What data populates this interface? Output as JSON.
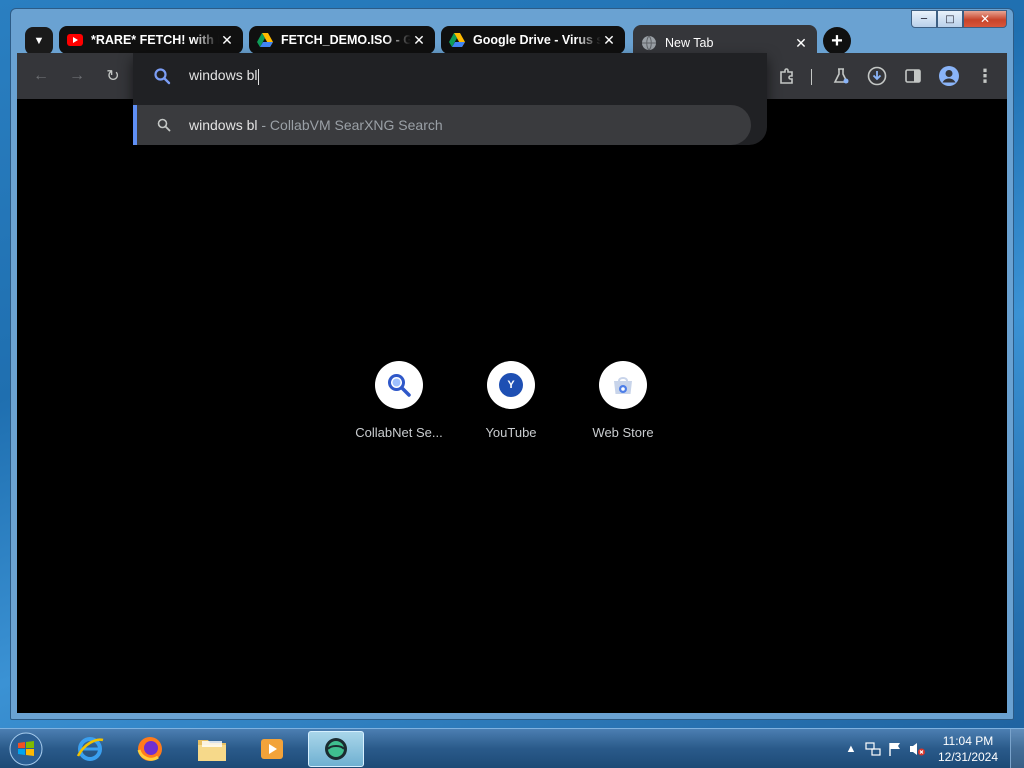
{
  "browser": {
    "tabs": [
      {
        "title": "*RARE* FETCH! with R",
        "favicon": "youtube-icon",
        "active": false
      },
      {
        "title": "FETCH_DEMO.ISO - G",
        "favicon": "google-drive-icon",
        "active": false
      },
      {
        "title": "Google Drive - Virus s",
        "favicon": "google-drive-icon",
        "active": false
      },
      {
        "title": "New Tab",
        "favicon": "globe-icon",
        "active": true
      }
    ],
    "omnibox": {
      "input_value": "windows bl",
      "suggestion_query": "windows bl",
      "suggestion_engine": " - CollabVM SearXNG Search"
    },
    "shortcuts": [
      {
        "label": "CollabNet Se...",
        "icon": "search-icon",
        "initial": ""
      },
      {
        "label": "YouTube",
        "icon": "letter-y-icon",
        "initial": "Y"
      },
      {
        "label": "Web Store",
        "icon": "web-store-icon",
        "initial": ""
      }
    ],
    "colors": {
      "toolbar": "#35363a",
      "content": "#000000",
      "accent": "#5f8ff5"
    }
  },
  "taskbar": {
    "apps": [
      "internet-explorer-icon",
      "firefox-icon",
      "file-explorer-icon",
      "media-player-icon",
      "collabvm-icon"
    ],
    "clock_time": "11:04 PM",
    "clock_date": "12/31/2024"
  }
}
